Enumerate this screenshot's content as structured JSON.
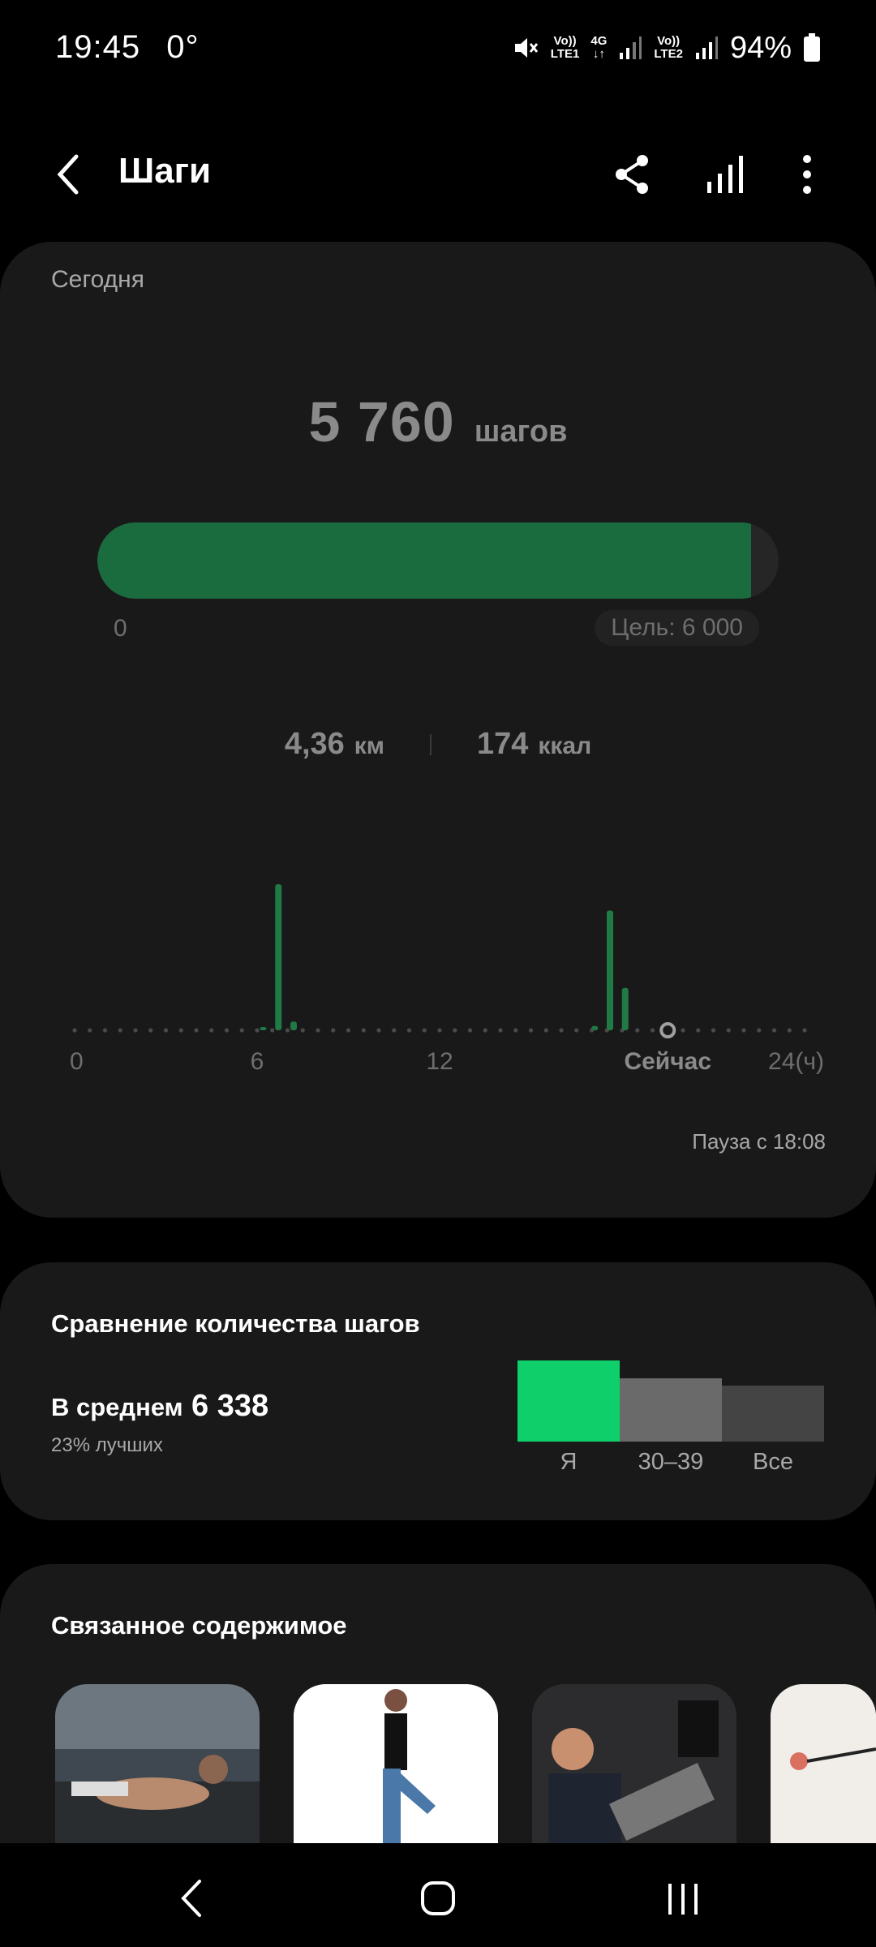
{
  "status_bar": {
    "time": "19:45",
    "temperature": "0°",
    "sim1_label_top": "Vo))",
    "sim1_label_bottom": "LTE1",
    "network_type": "4G",
    "sim2_label_top": "Vo))",
    "sim2_label_bottom": "LTE2",
    "battery": "94%"
  },
  "header": {
    "title": "Шаги"
  },
  "today": {
    "label": "Сегодня",
    "steps": "5 760",
    "steps_unit": "шагов",
    "progress_fraction": 0.96,
    "progress_start": "0",
    "goal": "Цель: 6 000",
    "distance": "4,36",
    "distance_unit": "км",
    "calories": "174",
    "calories_unit": "ккал",
    "pause_text": "Пауза с 18:08"
  },
  "chart_data": {
    "type": "bar",
    "x_tick_labels": [
      "0",
      "6",
      "12",
      "Сейчас",
      "24(ч)"
    ],
    "x_tick_hours": [
      0,
      6,
      12,
      19.5,
      24
    ],
    "now_hour": 19.5,
    "x_range": [
      0,
      24
    ],
    "relative_max": 1.0,
    "bars": [
      {
        "hour": 6.2,
        "value": 0.02
      },
      {
        "hour": 6.7,
        "value": 1.0
      },
      {
        "hour": 7.2,
        "value": 0.06
      },
      {
        "hour": 17.1,
        "value": 0.03
      },
      {
        "hour": 17.6,
        "value": 0.82
      },
      {
        "hour": 18.1,
        "value": 0.29
      }
    ],
    "colors": {
      "bar": "#1f7a45",
      "dot": "#4a4a4a",
      "now_marker": "#a0a0a0"
    }
  },
  "comparison": {
    "title": "Сравнение количества шагов",
    "average_label": "В среднем",
    "average_value": "6 338",
    "percentile": "23% лучших",
    "bars": [
      {
        "label": "Я",
        "value": 1.0,
        "color": "#0fcf6a"
      },
      {
        "label": "30–39",
        "value": 0.78,
        "color": "#6a6a6a"
      },
      {
        "label": "Все",
        "value": 0.69,
        "color": "#444444"
      }
    ]
  },
  "related": {
    "title": "Связанное содержимое",
    "thumbnails": [
      "crunches-photo",
      "stretching-photo",
      "leg-press-photo",
      "resistance-band-photo"
    ]
  },
  "icons": {
    "back": "chevron-left-icon",
    "share": "share-icon",
    "stats": "bar-chart-icon",
    "more": "more-vert-icon",
    "nav_back": "nav-back-icon",
    "nav_home": "nav-home-icon",
    "nav_recents": "nav-recents-icon"
  }
}
